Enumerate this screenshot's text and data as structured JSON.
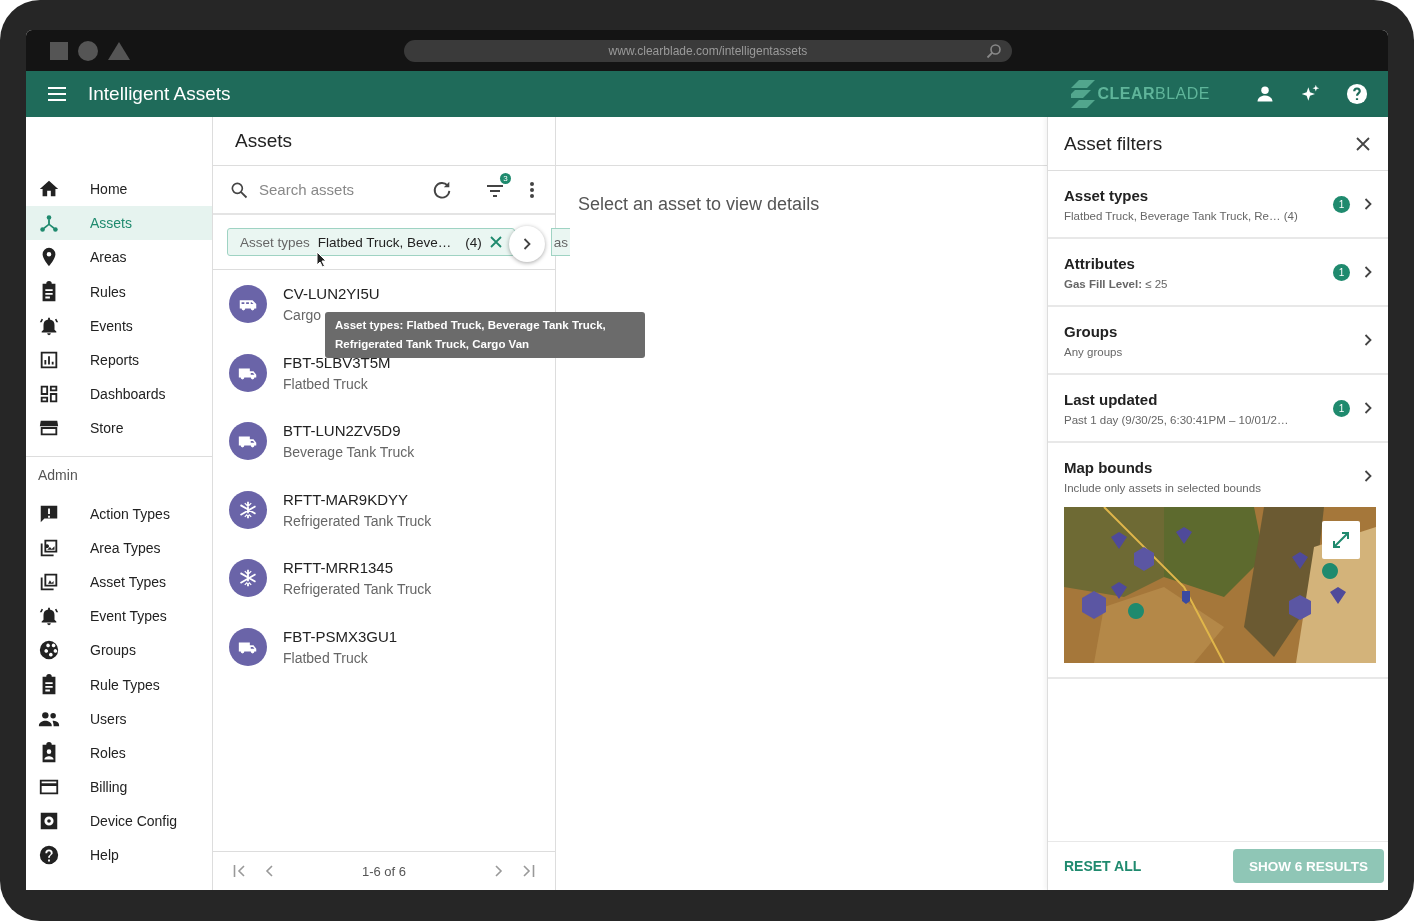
{
  "browser": {
    "url": "www.clearblade.com/intelligentassets"
  },
  "app_bar": {
    "title": "Intelligent Assets",
    "logo_bold": "CLEAR",
    "logo_light": "BLADE"
  },
  "sidebar": {
    "items": [
      {
        "label": "Home",
        "selected": false
      },
      {
        "label": "Assets",
        "selected": true
      },
      {
        "label": "Areas",
        "selected": false
      },
      {
        "label": "Rules",
        "selected": false
      },
      {
        "label": "Events",
        "selected": false
      },
      {
        "label": "Reports",
        "selected": false
      },
      {
        "label": "Dashboards",
        "selected": false
      },
      {
        "label": "Store",
        "selected": false
      }
    ],
    "admin_heading": "Admin",
    "admin_items": [
      {
        "label": "Action Types",
        "selected": false
      },
      {
        "label": "Area Types",
        "selected": false
      },
      {
        "label": "Asset Types",
        "selected": false
      },
      {
        "label": "Event Types",
        "selected": false
      },
      {
        "label": "Groups",
        "selected": false
      },
      {
        "label": "Rule Types",
        "selected": false
      },
      {
        "label": "Users",
        "selected": false
      },
      {
        "label": "Roles",
        "selected": false
      },
      {
        "label": "Billing",
        "selected": false
      },
      {
        "label": "Device Config",
        "selected": false
      },
      {
        "label": "Help",
        "selected": false
      }
    ]
  },
  "assets_panel": {
    "title": "Assets",
    "search": {
      "placeholder": "Search assets"
    },
    "filter_count": "3",
    "chips": [
      {
        "label": "Asset types",
        "value": "Flatbed Truck, Beve…",
        "count": "(4)"
      }
    ],
    "cut_chip": "as",
    "tooltip": "Asset types: Flatbed Truck, Beverage Tank Truck, Refrigerated Tank Truck, Cargo Van",
    "assets": [
      {
        "kind": "van",
        "name": "CV-LUN2YI5U",
        "type": "Cargo"
      },
      {
        "kind": "truck",
        "name": "FBT-5LBV3T5M",
        "type": "Flatbed Truck"
      },
      {
        "kind": "truck",
        "name": "BTT-LUN2ZV5D9",
        "type": "Beverage Tank Truck"
      },
      {
        "kind": "refrigerated",
        "name": "RFTT-MAR9KDYY",
        "type": "Refrigerated Tank Truck"
      },
      {
        "kind": "refrigerated",
        "name": "RFTT-MRR1345",
        "type": "Refrigerated Tank Truck"
      },
      {
        "kind": "truck",
        "name": "FBT-PSMX3GU1",
        "type": "Flatbed Truck"
      }
    ],
    "pager": "1-6 of 6"
  },
  "details": {
    "empty_text": "Select an asset to view details"
  },
  "filters": {
    "title": "Asset filters",
    "sections": [
      {
        "kind": "text",
        "title": "Asset types",
        "summary": "Flatbed Truck, Beverage Tank Truck, Re…  (4)",
        "badge": "1"
      },
      {
        "kind": "text",
        "title": "Attributes",
        "summary": "**Gas Fill Level:** ≤ 25",
        "badge": "1"
      },
      {
        "kind": "text",
        "title": "Groups",
        "summary": "Any groups"
      },
      {
        "kind": "text",
        "title": "Last updated",
        "summary": "Past 1 day (9/30/25, 6:30:41PM – 10/01/2…",
        "badge": "1"
      },
      {
        "kind": "map",
        "title": "Map bounds",
        "summary": "Include only assets in selected bounds"
      }
    ],
    "reset": "RESET ALL",
    "apply": {
      "label": "SHOW 6 RESULTS",
      "disabled": true
    }
  }
}
